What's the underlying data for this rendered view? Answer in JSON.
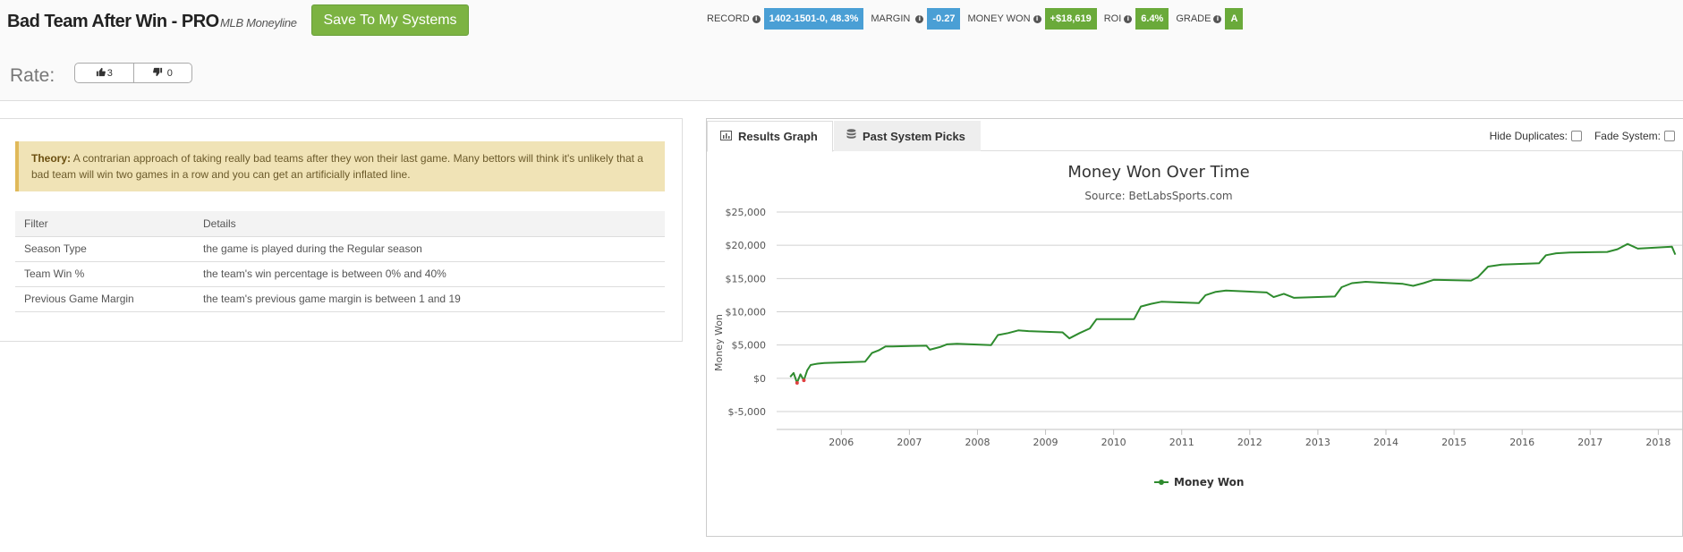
{
  "header": {
    "title": "Bad Team After Win - PRO",
    "subtitle": "MLB Moneyline",
    "save_button": "Save To My Systems"
  },
  "stats": [
    {
      "label": "RECORD",
      "value": "1402-1501-0, 48.3%",
      "color": "#4a9fd5"
    },
    {
      "label": "MARGIN",
      "value": "-0.27",
      "color": "#4a9fd5"
    },
    {
      "label": "MONEY WON",
      "value": "+$18,619",
      "color": "#6aaa3a"
    },
    {
      "label": "ROI",
      "value": "6.4%",
      "color": "#6aaa3a"
    },
    {
      "label": "GRADE",
      "value": "A",
      "color": "#6aaa3a"
    }
  ],
  "rate": {
    "label": "Rate:",
    "up_count": "3",
    "down_count": "0"
  },
  "theory": {
    "label": "Theory:",
    "text": "A contrarian approach of taking really bad teams after they won their last game. Many bettors will think it's unlikely that a bad team will win two games in a row and you can get an artificially inflated line."
  },
  "filters": {
    "headers": [
      "Filter",
      "Details"
    ],
    "rows": [
      [
        "Season Type",
        "the game is played during the Regular season"
      ],
      [
        "Team Win %",
        "the team's win percentage is between 0% and 40%"
      ],
      [
        "Previous Game Margin",
        "the team's previous game margin is between 1 and 19"
      ]
    ]
  },
  "tabs": {
    "results_graph": "Results Graph",
    "past_picks": "Past System Picks",
    "hide_duplicates": "Hide Duplicates:",
    "fade_system": "Fade System:"
  },
  "chart_data": {
    "type": "line",
    "title": "Money Won Over Time",
    "subtitle": "Source: BetLabsSports.com",
    "ylabel": "Money Won",
    "ylim": [
      -5000,
      25000
    ],
    "yticks": [
      -5000,
      0,
      5000,
      10000,
      15000,
      20000,
      25000
    ],
    "ytick_labels": [
      "$-5,000",
      "$0",
      "$5,000",
      "$10,000",
      "$15,000",
      "$20,000",
      "$25,000"
    ],
    "xlim": [
      2005.05,
      2018.35
    ],
    "xticks": [
      "2006",
      "2007",
      "2008",
      "2009",
      "2010",
      "2011",
      "2012",
      "2013",
      "2014",
      "2015",
      "2016",
      "2017",
      "2018"
    ],
    "grid": true,
    "legend": "bottom-center",
    "series": [
      {
        "name": "Money Won",
        "color": "#2e8b2e",
        "negative_color": "#e04040",
        "x": [
          2005.25,
          2005.3,
          2005.35,
          2005.4,
          2005.45,
          2005.5,
          2005.55,
          2005.6,
          2005.65,
          2005.75,
          2006.35,
          2006.45,
          2006.55,
          2006.65,
          2006.75,
          2007.25,
          2007.3,
          2007.45,
          2007.55,
          2007.7,
          2008.2,
          2008.3,
          2008.45,
          2008.6,
          2008.75,
          2009.25,
          2009.35,
          2009.5,
          2009.65,
          2009.75,
          2010.3,
          2010.4,
          2010.55,
          2010.7,
          2011.25,
          2011.35,
          2011.5,
          2011.65,
          2012.25,
          2012.35,
          2012.5,
          2012.65,
          2013.25,
          2013.35,
          2013.5,
          2013.7,
          2014.25,
          2014.4,
          2014.55,
          2014.7,
          2015.25,
          2015.35,
          2015.5,
          2015.7,
          2016.25,
          2016.35,
          2016.5,
          2016.7,
          2017.25,
          2017.4,
          2017.55,
          2017.7,
          2018.2,
          2018.25
        ],
        "y": [
          200,
          800,
          -700,
          600,
          -300,
          1200,
          2000,
          2100,
          2200,
          2300,
          2500,
          3800,
          4200,
          4800,
          4800,
          4900,
          4300,
          4700,
          5100,
          5200,
          5000,
          6500,
          6800,
          7200,
          7100,
          6900,
          6000,
          6800,
          7500,
          8900,
          8900,
          10800,
          11200,
          11500,
          11300,
          12500,
          13000,
          13200,
          12900,
          12200,
          12700,
          12100,
          12300,
          13700,
          14300,
          14500,
          14200,
          13900,
          14300,
          14800,
          14700,
          15200,
          16800,
          17100,
          17300,
          18500,
          18800,
          18900,
          19000,
          19400,
          20200,
          19500,
          19800,
          18600
        ]
      }
    ]
  }
}
